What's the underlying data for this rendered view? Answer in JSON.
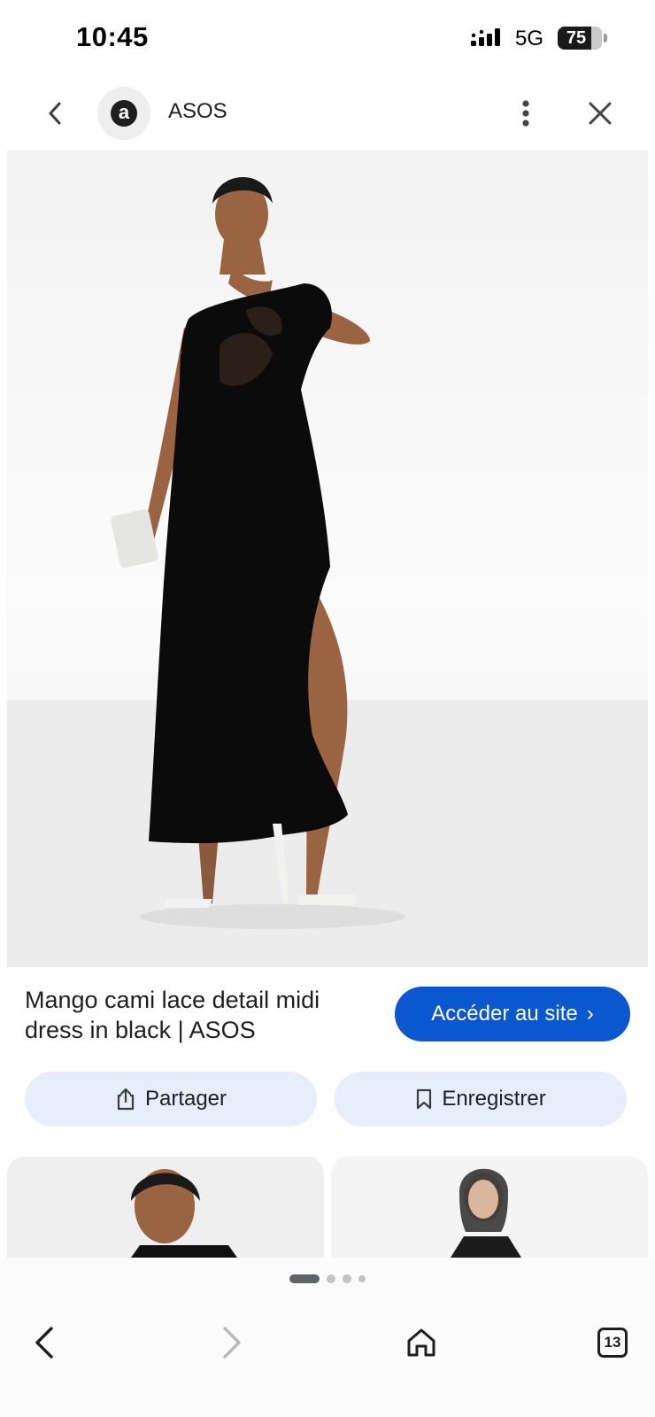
{
  "status_bar": {
    "time": "10:45",
    "network": "5G",
    "battery": "75",
    "battery_level_percent": 75
  },
  "header": {
    "site_name": "ASOS",
    "site_logo_letter": "a",
    "icons": {
      "back": "chevron-left-icon",
      "more": "more-vert-icon",
      "close": "close-icon"
    }
  },
  "product": {
    "title": "Mango cami lace detail midi dress in black | ASOS",
    "visit_label": "Accéder au site",
    "share_label": "Partager",
    "save_label": "Enregistrer"
  },
  "bottom_nav": {
    "tab_count": "13",
    "icons": {
      "back": "arrow-back-icon",
      "forward": "arrow-forward-icon",
      "home": "home-icon",
      "tabs": "tabs-icon"
    }
  },
  "colors": {
    "accent": "#0b57d0",
    "chip_bg": "#e6eefc",
    "text": "#1f1f1f"
  }
}
